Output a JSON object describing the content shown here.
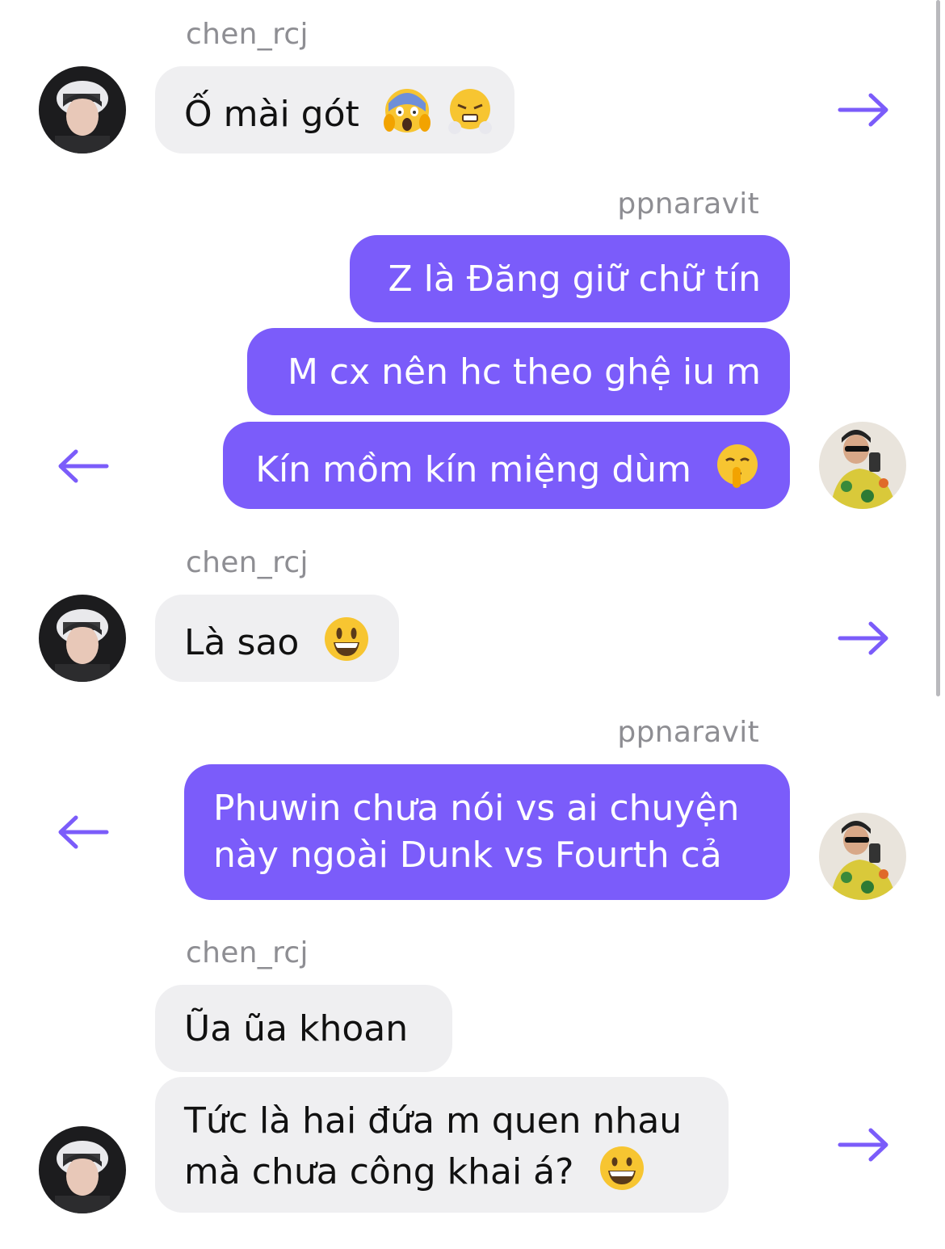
{
  "colors": {
    "outgoing_bubble": "#7b5cfa",
    "incoming_bubble": "#efeff1",
    "arrow": "#7b5cfa",
    "sender_name": "#8e8e93"
  },
  "messages": [
    {
      "sender": "chen_rcj",
      "lines": [
        "Ố mài gót"
      ],
      "emojis": [
        "face-screaming-in-fear-emoji",
        "face-with-steam-emoji"
      ]
    },
    {
      "sender": "ppnaravit",
      "lines": [
        "Z là Đăng giữ chữ tín"
      ]
    },
    {
      "lines": [
        "M cx nên hc theo ghệ iu m"
      ]
    },
    {
      "lines": [
        "Kín mồm kín miệng dùm"
      ],
      "emojis": [
        "shushing-face-emoji"
      ]
    },
    {
      "sender": "chen_rcj",
      "lines": [
        "Là sao"
      ],
      "emojis": [
        "grinning-face-big-eyes-emoji"
      ]
    },
    {
      "sender": "ppnaravit",
      "lines": [
        "Phuwin chưa nói vs ai chuyện",
        "này ngoài Dunk vs Fourth cả"
      ]
    },
    {
      "sender": "chen_rcj",
      "lines": [
        "Ũa ũa khoan"
      ]
    },
    {
      "lines": [
        "Tức là hai đứa m quen nhau",
        "mà chưa công khai á?"
      ],
      "emojis": [
        "grinning-face-emoji"
      ]
    }
  ]
}
